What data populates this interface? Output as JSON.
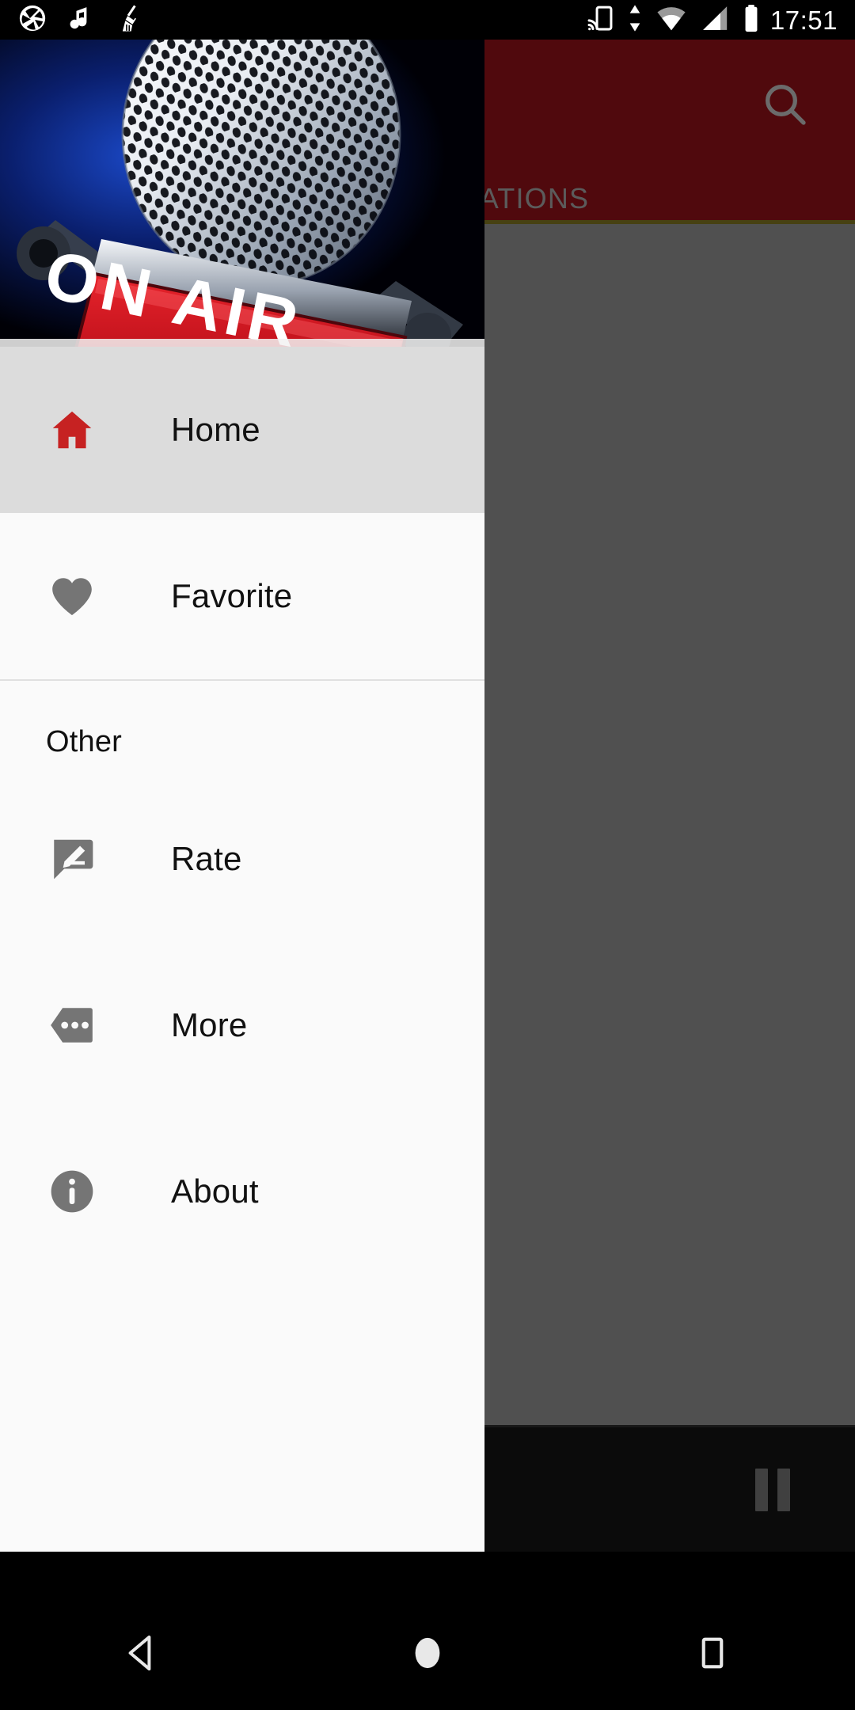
{
  "status_bar": {
    "time": "17:51",
    "left_icons": [
      "camera-aperture-icon",
      "music-note-icon",
      "broom-icon"
    ],
    "right_icons": [
      "cast-icon",
      "data-transfer-icon",
      "wifi-icon",
      "signal-icon",
      "battery-icon"
    ]
  },
  "app": {
    "appbar": {
      "background_color": "#8b1117",
      "search_icon": "search-icon",
      "tab_label": "STATIONS",
      "tab_indicator_color": "#7a7020"
    },
    "player": {
      "pause_icon": "pause-icon",
      "background_color": "#141414"
    },
    "content_background": "#8a8a8a"
  },
  "drawer": {
    "header": {
      "image_alt": "on-air-microphone-banner",
      "banner_text": "ON AIR"
    },
    "main_items": [
      {
        "label": "Home",
        "icon": "home-icon",
        "icon_color": "#c62222",
        "selected": true
      },
      {
        "label": "Favorite",
        "icon": "heart-icon",
        "icon_color": "#757575",
        "selected": false
      }
    ],
    "section_header": "Other",
    "other_items": [
      {
        "label": "Rate",
        "icon": "rate-feedback-icon",
        "icon_color": "#757575"
      },
      {
        "label": "More",
        "icon": "more-apps-icon",
        "icon_color": "#757575"
      },
      {
        "label": "About",
        "icon": "info-icon",
        "icon_color": "#757575"
      }
    ],
    "selected_background": "#dcdcdc",
    "background": "#fafafa"
  },
  "navigation_bar": {
    "buttons": [
      {
        "label": "Back",
        "icon": "back-triangle-icon"
      },
      {
        "label": "Home",
        "icon": "home-circle-icon"
      },
      {
        "label": "Recents",
        "icon": "recents-square-icon"
      }
    ]
  }
}
